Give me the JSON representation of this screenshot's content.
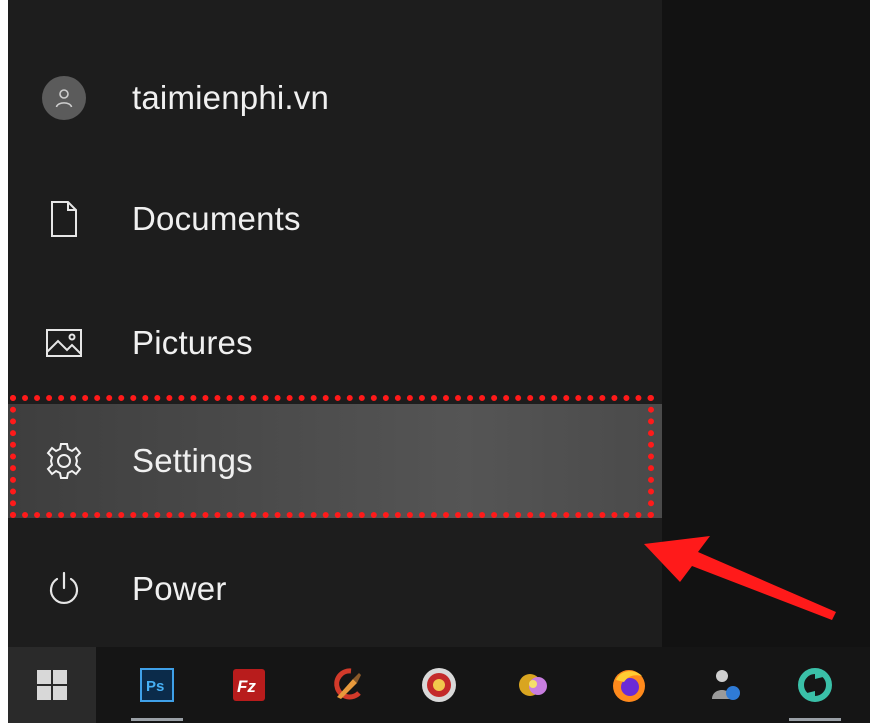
{
  "start_menu": {
    "items": [
      {
        "label": "taimienphi.vn",
        "icon": "user-avatar-icon"
      },
      {
        "label": "Documents",
        "icon": "document-icon"
      },
      {
        "label": "Pictures",
        "icon": "pictures-icon"
      },
      {
        "label": "Settings",
        "icon": "gear-icon",
        "highlighted": true
      },
      {
        "label": "Power",
        "icon": "power-icon"
      }
    ]
  },
  "annotation": {
    "highlight_color": "#ff1a1a",
    "arrow_color": "#ff1a1a"
  },
  "taskbar": {
    "apps": [
      {
        "name": "windows-start-icon",
        "text": ""
      },
      {
        "name": "photoshop-icon",
        "text": "Ps",
        "pinned_running": true
      },
      {
        "name": "filezilla-icon",
        "text": "Fz"
      },
      {
        "name": "ccleaner-icon",
        "text": ""
      },
      {
        "name": "app-badge-icon",
        "text": ""
      },
      {
        "name": "app-icon",
        "text": ""
      },
      {
        "name": "firefox-icon",
        "text": ""
      },
      {
        "name": "user-network-icon",
        "text": ""
      },
      {
        "name": "sync-app-icon",
        "text": "",
        "pinned_running": true
      }
    ]
  }
}
